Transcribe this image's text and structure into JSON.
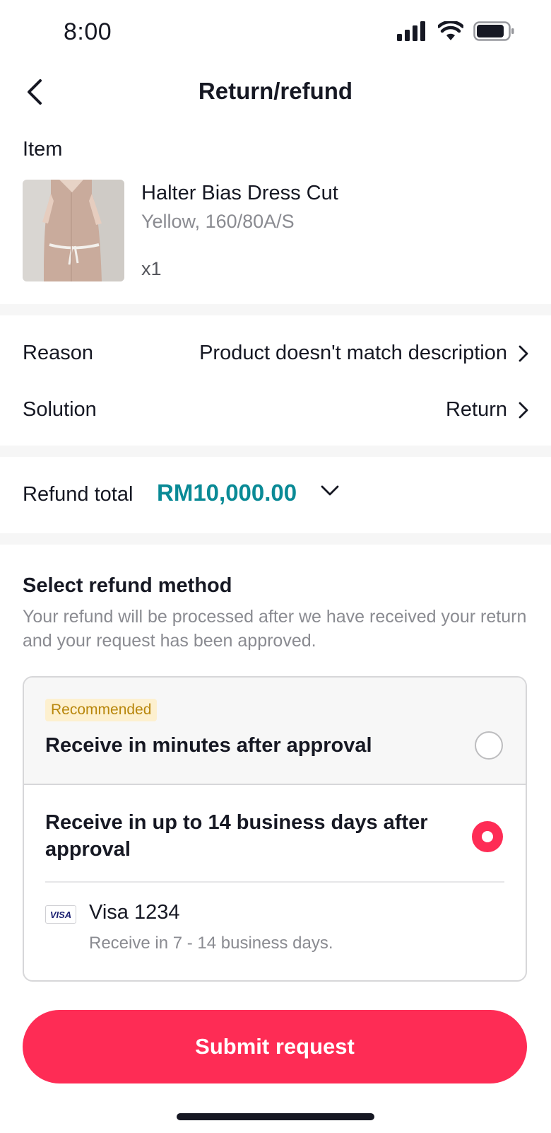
{
  "status_bar": {
    "time": "8:00"
  },
  "nav": {
    "title": "Return/refund",
    "back_icon": "chevron-left-icon"
  },
  "item_section": {
    "label": "Item",
    "product": {
      "name": "Halter Bias Dress Cut",
      "variant": "Yellow, 160/80A/S",
      "quantity": "x1"
    }
  },
  "details": {
    "reason": {
      "label": "Reason",
      "value": "Product doesn't match description"
    },
    "solution": {
      "label": "Solution",
      "value": "Return"
    }
  },
  "refund_total": {
    "label": "Refund total",
    "amount": "RM10,000.00"
  },
  "refund_method": {
    "title": "Select refund method",
    "description": "Your refund will be processed after we have received your return and your request has been approved.",
    "options": [
      {
        "badge": "Recommended",
        "label": "Receive in minutes after approval",
        "selected": false
      },
      {
        "label": "Receive in up to 14 business days after approval",
        "selected": true
      }
    ],
    "payment": {
      "logo_text": "VISA",
      "label": "Visa 1234",
      "note": "Receive in 7 - 14 business days."
    }
  },
  "submit_label": "Submit request",
  "colors": {
    "accent": "#fe2c55",
    "amount": "#0a8a96",
    "badge_bg": "#fdf0cf",
    "badge_text": "#b8860b"
  }
}
